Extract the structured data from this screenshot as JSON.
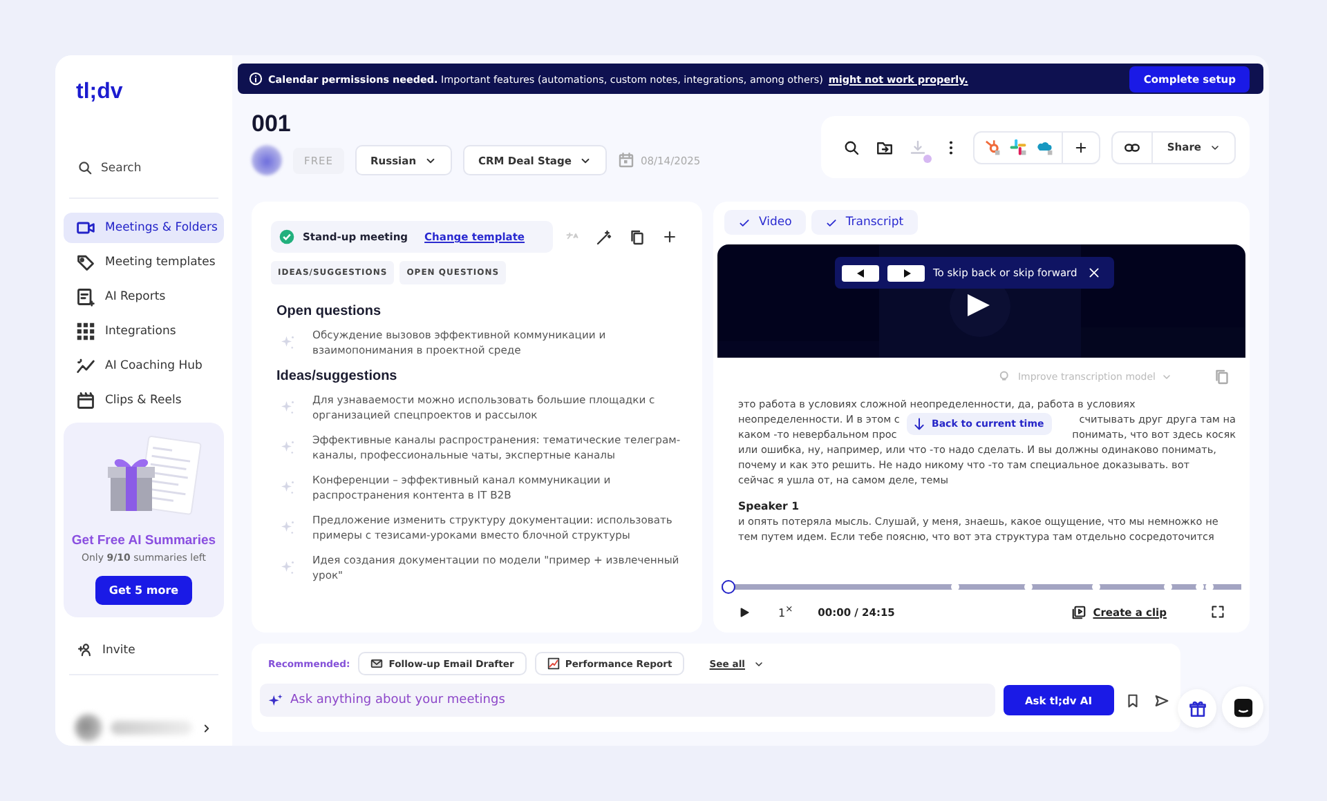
{
  "brand": "tl;dv",
  "sidebar": {
    "search": "Search",
    "items": [
      {
        "label": "Meetings & Folders",
        "selected": true
      },
      {
        "label": "Meeting templates",
        "selected": false
      },
      {
        "label": "AI Reports",
        "selected": false
      },
      {
        "label": "Integrations",
        "selected": false
      },
      {
        "label": "AI Coaching Hub",
        "selected": false
      },
      {
        "label": "Clips & Reels",
        "selected": false
      }
    ],
    "promo": {
      "title": "Get Free AI Summaries",
      "note": "Only **9/10** summaries left",
      "button": "Get 5 more"
    },
    "invite": "Invite"
  },
  "banner": {
    "text": "**Calendar permissions needed.** Important features (automations, custom notes, integrations, among others)",
    "link": "might not work properly.",
    "button": "Complete setup"
  },
  "meeting": {
    "title": "001",
    "plan": "FREE",
    "language": "Russian",
    "crm": "CRM Deal Stage",
    "date": "08/14/2025"
  },
  "toolbar": {
    "download": {
      "disabled": true
    },
    "share": "Share"
  },
  "notes": {
    "template": "Stand-up meeting",
    "change": "Change template",
    "chips": [
      "IDEAS/SUGGESTIONS",
      "OPEN QUESTIONS"
    ],
    "sections": [
      {
        "heading": "Open questions",
        "items": [
          "Обсуждение вызовов эффективной коммуникации и взаимопонимания в проектной среде"
        ]
      },
      {
        "heading": "Ideas/suggestions",
        "items": [
          "Для узнаваемости можно использовать большие площадки с организацией спецпроектов и рассылок",
          "Эффективные каналы распространения: тематические телеграм-каналы, профессиональные чаты, экспертные каналы",
          "Конференции – эффективный канал коммуникации и распространения контента в IT B2B",
          "Предложение изменить структуру документации: использовать примеры с тезисами-уроками вместо блочной структуры",
          "Идея создания документации по модели \"пример + извлеченный урок\""
        ]
      }
    ]
  },
  "player": {
    "tabs": [
      {
        "label": "Video",
        "checked": true
      },
      {
        "label": "Transcript",
        "checked": true
      }
    ],
    "hint": "To skip back or skip forward",
    "improve": "Improve transcription model",
    "back": "Back to current time",
    "transcript": [
      {
        "lines": [
          [
            "это работа в условиях сложной неопределенности, да, работа в условиях"
          ],
          [
            "неопределенности. И в этом с",
            "считывать друг друга там на"
          ],
          [
            "каком -то невербальном прос",
            "понимать, что вот здесь косяк"
          ],
          [
            "или ошибка, ну, например, или что -то надо сделать. И вы должны одинаково понимать,"
          ],
          [
            "почему и как это решить. Не надо никому что -то там специальное доказывать. вот"
          ],
          [
            "сейчас я ушла от, на самом деле, темы"
          ]
        ]
      },
      {
        "speaker": "Speaker 1",
        "lines": [
          [
            "и опять потеряла мысль. Слушай, у меня, знаешь, какое ощущение, что мы немножко не"
          ],
          [
            "тем путем идем. Если тебе поясню, что вот эта структура там отдельно сосредоточится"
          ]
        ]
      }
    ],
    "progress": {
      "level": 0
    },
    "speed": "1$^{×}$",
    "time": "00:00 / 24:15",
    "clip": "Create a clip"
  },
  "assistant": {
    "recommended": "Recommended:",
    "chips": [
      {
        "label": "Follow-up Email Drafter"
      },
      {
        "label": "Performance Report"
      }
    ],
    "see_all": "See all",
    "placeholder": "Ask anything about your meetings",
    "button": "Ask tl;dv AI"
  }
}
